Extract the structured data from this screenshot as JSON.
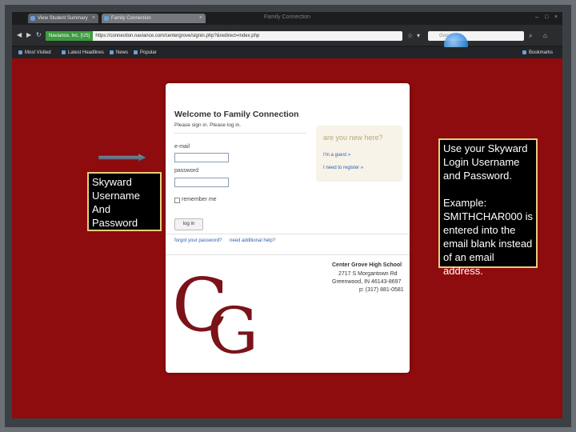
{
  "browser": {
    "window_title": "Family Connection",
    "tabs": [
      {
        "label": "View Student Summary"
      },
      {
        "label": "Family Connection"
      }
    ],
    "url_badge": "Naviance, Inc. [US]",
    "url": "https://connection.naviance.com/centergrove/signin.php?&redirect=index.php",
    "search_placeholder": "Google",
    "bookmarks": [
      {
        "label": "Most Visited"
      },
      {
        "label": "Latest Headlines"
      },
      {
        "label": "News"
      },
      {
        "label": "Popular"
      }
    ],
    "bookmarks_menu": "Bookmarks"
  },
  "login": {
    "title": "Welcome to Family Connection",
    "subtitle": "Please sign in. Please log in.",
    "email_label": "e-mail",
    "password_label": "password",
    "remember_label": "remember me",
    "login_button": "log in",
    "forgot_link": "forgot your password?",
    "help_link": "need additional help?",
    "new_here": "are you new here?",
    "guest_link": "I'm a guest »",
    "register_link": "I need to register »"
  },
  "school": {
    "name": "Center Grove High School",
    "address1": "2717 S Morgantown Rd",
    "address2": "Greenwood, IN 46143-8697",
    "phone": "p: (317) 881-0581",
    "logo_c": "C",
    "logo_g": "G"
  },
  "callouts": {
    "left": "Skyward Username And Password",
    "right_line1": "Use your Skyward Login Username and Password.",
    "right_line2": "Example: SMITHCHAR000 is entered into the email blank instead of an email address."
  },
  "colors": {
    "background": "#8e0b0e",
    "callout_border": "#e3d07a",
    "logo": "#7b1318"
  }
}
